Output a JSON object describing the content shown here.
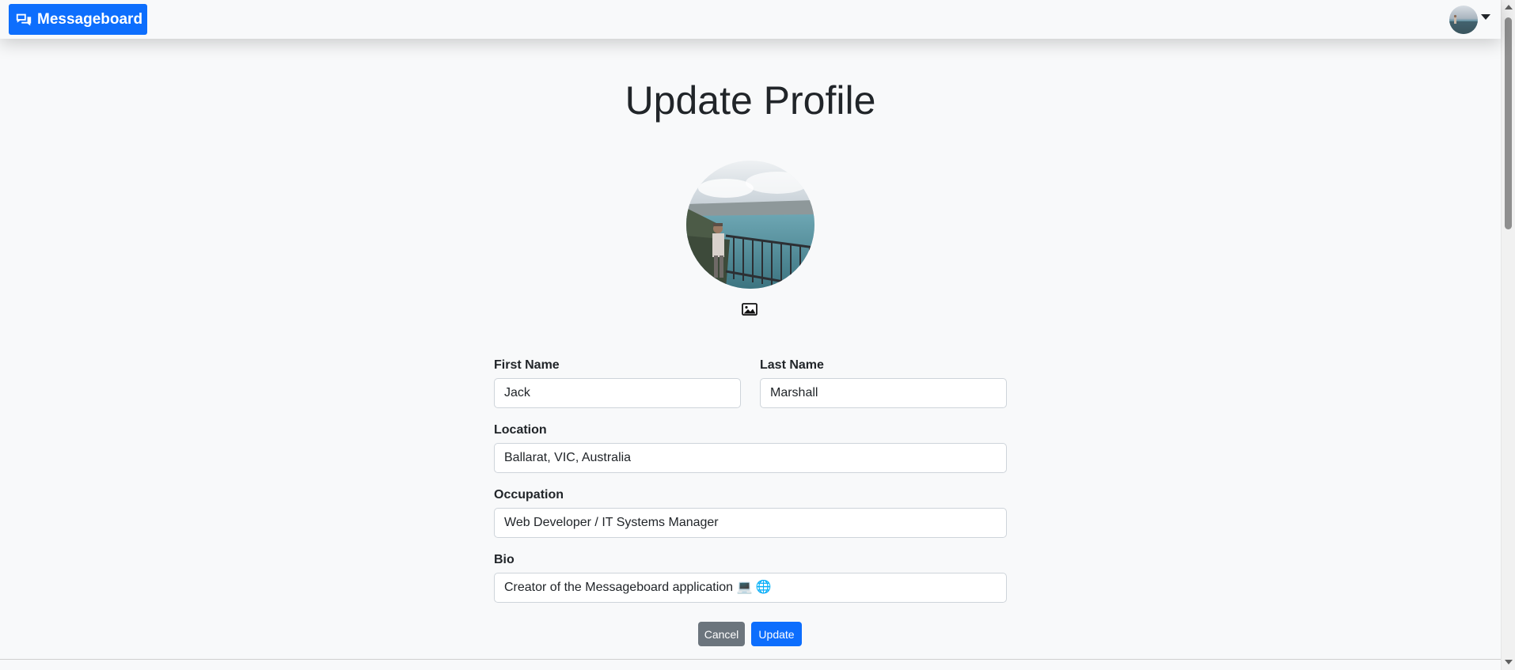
{
  "navbar": {
    "brand_label": "Messageboard",
    "brand_icon": "chat-bubbles-icon",
    "avatar_icon": "user-avatar",
    "menu_icon": "caret-down-icon"
  },
  "page": {
    "title": "Update Profile",
    "photo_upload_icon": "image-icon"
  },
  "form": {
    "first_name": {
      "label": "First Name",
      "value": "Jack"
    },
    "last_name": {
      "label": "Last Name",
      "value": "Marshall"
    },
    "location": {
      "label": "Location",
      "value": "Ballarat, VIC, Australia"
    },
    "occupation": {
      "label": "Occupation",
      "value": "Web Developer / IT Systems Manager"
    },
    "bio": {
      "label": "Bio",
      "value": "Creator of the Messageboard application 💻 🌐"
    }
  },
  "buttons": {
    "cancel_label": "Cancel",
    "update_label": "Update"
  },
  "colors": {
    "primary": "#0d6efd",
    "secondary": "#6c757d",
    "background": "#f8f9fa"
  }
}
